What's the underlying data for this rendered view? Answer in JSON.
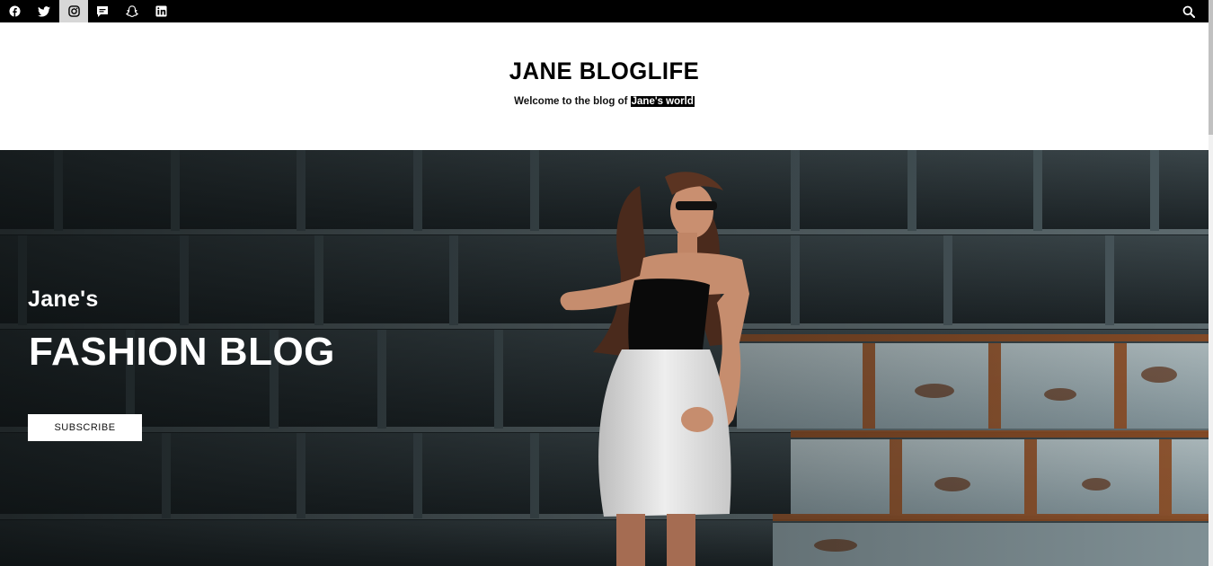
{
  "social": [
    {
      "name": "facebook",
      "active": false
    },
    {
      "name": "twitter",
      "active": false
    },
    {
      "name": "instagram",
      "active": true
    },
    {
      "name": "chat",
      "active": false
    },
    {
      "name": "snapchat",
      "active": false
    },
    {
      "name": "linkedin",
      "active": false
    }
  ],
  "header": {
    "title": "JANE BLOGLIFE",
    "tagline_prefix": "Welcome to the blog of ",
    "tagline_highlight": "Jane's world"
  },
  "hero": {
    "kicker": "Jane's",
    "title": "FASHION BLOG",
    "button_label": "SUBSCRIBE"
  },
  "colors": {
    "topbar": "#000000",
    "active_social": "#d7d7d7",
    "hero_text": "#ffffff",
    "rust": "#8a4a22",
    "steel": "#8ea1a8"
  }
}
